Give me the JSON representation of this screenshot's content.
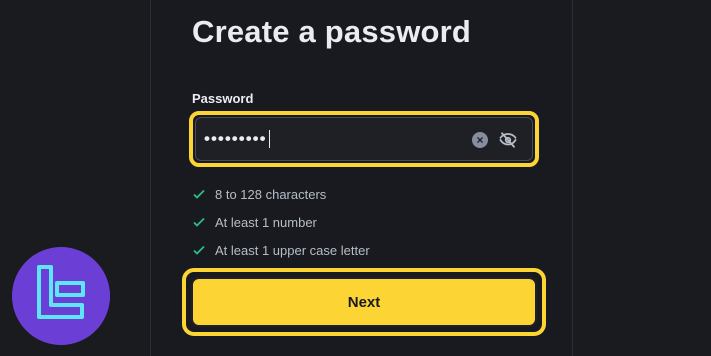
{
  "form": {
    "title": "Create a password",
    "password_label": "Password",
    "password_value": "•••••••••",
    "rules": [
      {
        "text": "8 to 128 characters",
        "status": "met"
      },
      {
        "text": "At least 1 number",
        "status": "met"
      },
      {
        "text": "At least 1 upper case letter",
        "status": "met"
      }
    ],
    "next_label": "Next",
    "clear_icon": "×"
  },
  "colors": {
    "accent": "#fcd535",
    "check": "#2ebd85",
    "logo_bg": "#6b3fd6",
    "logo_fg": "#5ee6f6"
  },
  "icons": [
    "clear-icon",
    "eye-slash-icon",
    "check-icon",
    "brand-logo-icon"
  ]
}
